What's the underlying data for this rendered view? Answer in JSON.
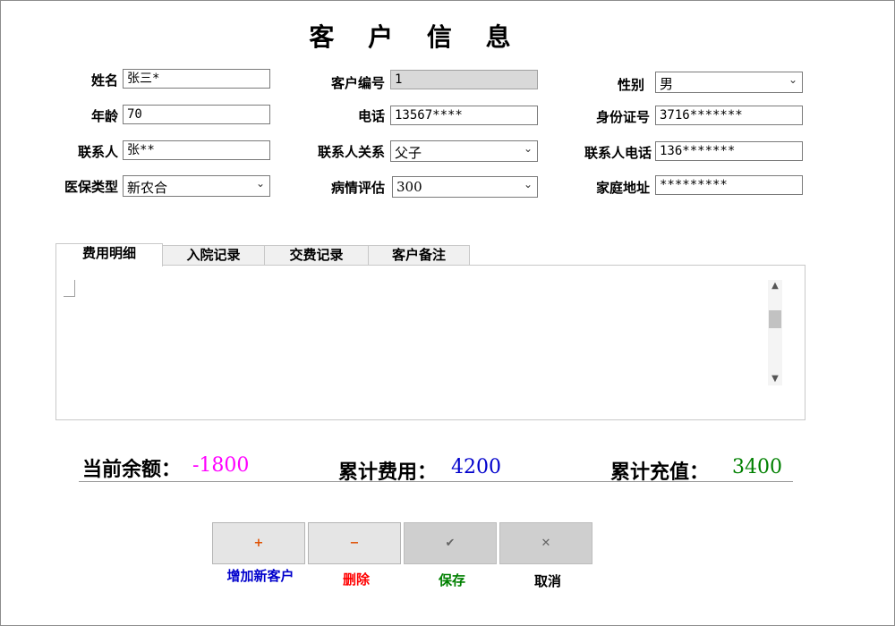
{
  "title": "客 户 信 息",
  "form": {
    "name_label": "姓名",
    "name_value": "张三*",
    "customer_no_label": "客户编号",
    "customer_no_value": "1",
    "gender_label": "性别",
    "gender_value": "男",
    "age_label": "年龄",
    "age_value": "70",
    "phone_label": "电话",
    "phone_value": "13567****",
    "id_card_label": "身份证号",
    "id_card_value": "3716*******",
    "contact_label": "联系人",
    "contact_value": "张**",
    "relation_label": "联系人关系",
    "relation_value": "父子",
    "contact_phone_label": "联系人电话",
    "contact_phone_value": "136*******",
    "insurance_label": "医保类型",
    "insurance_value": "新农合",
    "condition_label": "病情评估",
    "condition_value": "300",
    "address_label": "家庭地址",
    "address_value": "*********"
  },
  "tabs": [
    {
      "label": "费用明细",
      "active": true
    },
    {
      "label": "入院记录",
      "active": false
    },
    {
      "label": "交费记录",
      "active": false
    },
    {
      "label": "客户备注",
      "active": false
    }
  ],
  "summary": {
    "balance_label": "当前余额：",
    "balance_value": "-1800",
    "total_cost_label": "累计费用：",
    "total_cost_value": "4200",
    "total_recharge_label": "累计充值：",
    "total_recharge_value": "3400",
    "colors": {
      "balance": "#ff00ff",
      "cost": "#0000cc",
      "recharge": "#008000"
    }
  },
  "buttons": {
    "add": {
      "icon": "+",
      "label": "增加新客户",
      "color": "#0000cc"
    },
    "delete": {
      "icon": "−",
      "label": "删除",
      "color": "#ff0000"
    },
    "save": {
      "icon": "✔",
      "label": "保存",
      "color": "#008000"
    },
    "cancel": {
      "icon": "✕",
      "label": "取消",
      "color": "#000000"
    }
  },
  "icons": {
    "dropdown": "chevron-down-icon",
    "scroll_up": "chevron-up-icon",
    "scroll_down": "chevron-down-icon"
  }
}
